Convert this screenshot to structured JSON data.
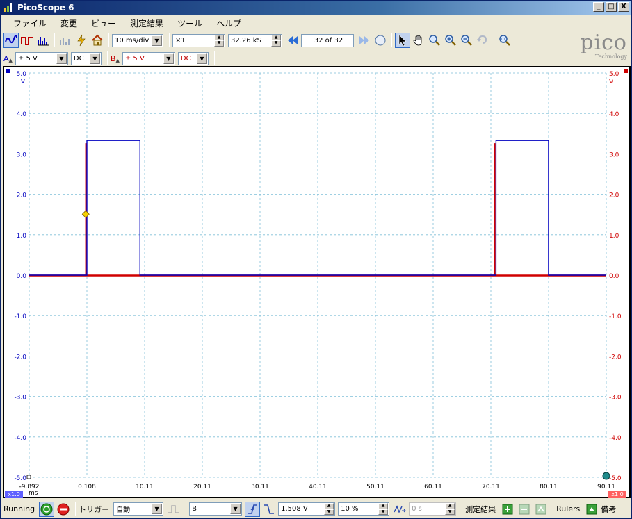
{
  "app": {
    "title": "PicoScope 6"
  },
  "window_buttons": {
    "minimize": "_",
    "maximize": "□",
    "close": "X"
  },
  "menu": [
    "ファイル",
    "変更",
    "ビュー",
    "測定結果",
    "ツール",
    "ヘルプ"
  ],
  "toolbar": {
    "timebase": "10 ms/div",
    "zoom": "×1",
    "samples": "32.26 kS",
    "buffer": "32 of 32"
  },
  "channels": {
    "a": {
      "name": "A",
      "range": "± 5 V",
      "coupling": "DC",
      "color": "#0000c0"
    },
    "b": {
      "name": "B",
      "range": "± 5 V",
      "coupling": "DC",
      "color": "#d00000"
    }
  },
  "logo": {
    "text": "pico",
    "subtext": "Technology"
  },
  "scope": {
    "y_ticks": [
      "5.0",
      "4.0",
      "3.0",
      "2.0",
      "1.0",
      "0.0",
      "-1.0",
      "-2.0",
      "-3.0",
      "-4.0",
      "-5.0"
    ],
    "y_unit": "V",
    "x_ticks": [
      "-9.892",
      "0.108",
      "10.11",
      "20.11",
      "30.11",
      "40.11",
      "50.11",
      "60.11",
      "70.11",
      "80.11",
      "90.11"
    ],
    "x_unit": "ms",
    "zoom_tag": "x1.0",
    "trigger_marker_level": 1.508,
    "channel_a_pulses": [
      {
        "start": 0.108,
        "end": 9.3,
        "high": 3.33
      },
      {
        "start": 71.0,
        "end": 80.1,
        "high": 3.33
      }
    ],
    "channel_b_spikes": [
      {
        "t": -0.1,
        "high": 3.25
      },
      {
        "t": 70.7,
        "high": 3.25
      }
    ],
    "grid_color": "#7fbfd8"
  },
  "status": {
    "state": "Running",
    "trigger_label": "トリガー",
    "trigger_mode": "自動",
    "trigger_source": "B",
    "threshold": "1.508 V",
    "pretrigger": "10 %",
    "delay": "0 s",
    "measurements_label": "測定結果",
    "rulers_label": "Rulers",
    "notes_label": "備考"
  }
}
